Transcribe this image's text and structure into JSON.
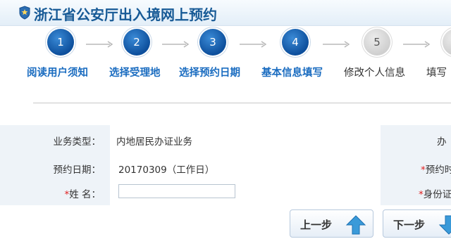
{
  "header": {
    "title": "浙江省公安厅出入境网上预约"
  },
  "steps": [
    {
      "number": "1",
      "label": "阅读用户须知",
      "state": "active"
    },
    {
      "number": "2",
      "label": "选择受理地",
      "state": "active"
    },
    {
      "number": "3",
      "label": "选择预约日期",
      "state": "active"
    },
    {
      "number": "4",
      "label": "基本信息填写",
      "state": "active"
    },
    {
      "number": "5",
      "label": "修改个人信息",
      "state": "inactive"
    },
    {
      "number": "",
      "label": "填写",
      "state": "inactive"
    }
  ],
  "form": {
    "business_type_label": "业务类型：",
    "business_type_value": "内地居民办证业务",
    "appointment_date_label": "预约日期：",
    "appointment_date_value": "20170309（工作日）",
    "name_required_mark": "*",
    "name_label": "姓 名：",
    "name_value": "",
    "right_col": {
      "row1_label": "办",
      "row2_required_mark": "*",
      "row2_label": "预约时",
      "row3_required_mark": "*",
      "row3_label": "身份证"
    }
  },
  "buttons": {
    "prev_label": "上一步",
    "next_label": "下一步"
  },
  "colors": {
    "brand_blue": "#175a96",
    "active_step": "#0d4f9c",
    "required": "#e02020"
  }
}
